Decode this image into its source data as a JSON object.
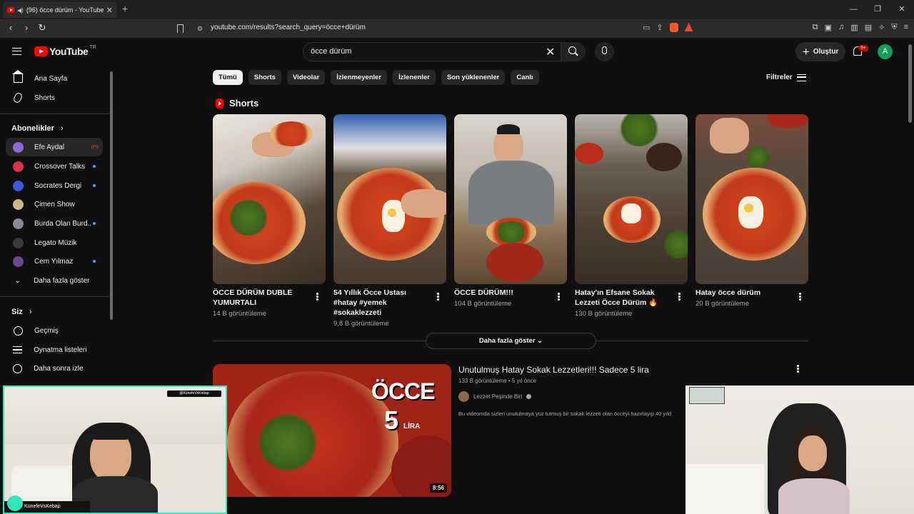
{
  "browser": {
    "tab_title": "(96) öcce dürüm - YouTube",
    "url": "youtube.com/results?search_query=öcce+dürüm"
  },
  "header": {
    "logo_text": "YouTube",
    "logo_region": "TR",
    "search_value": "öcce dürüm",
    "create_label": "Oluştur",
    "notif_count": "9+",
    "avatar_letter": "A"
  },
  "sidebar": {
    "main": [
      {
        "label": "Ana Sayfa",
        "icon": "home-icon"
      },
      {
        "label": "Shorts",
        "icon": "shorts-icon"
      }
    ],
    "subscriptions_title": "Abonelikler",
    "subscriptions": [
      {
        "label": "Efe Aydal",
        "avatar_color": "#8e6ad6",
        "status": "live"
      },
      {
        "label": "Crossover Talks",
        "avatar_color": "#d8344a",
        "status": "new"
      },
      {
        "label": "Socrates Dergi",
        "avatar_color": "#3d5bd6",
        "status": "new"
      },
      {
        "label": "Çimen Show",
        "avatar_color": "#c9b98a",
        "status": ""
      },
      {
        "label": "Burda Olan Burd...",
        "avatar_color": "#8b8b9a",
        "status": "new"
      },
      {
        "label": "Legato Müzik",
        "avatar_color": "#3a3a3a",
        "status": ""
      },
      {
        "label": "Cem Yılmaz",
        "avatar_color": "#6a4a8a",
        "status": "new"
      }
    ],
    "show_more": "Daha fazla göster",
    "you_title": "Siz",
    "you_items": [
      {
        "label": "Geçmiş",
        "icon": "history-icon"
      },
      {
        "label": "Oynatma listeleri",
        "icon": "playlist-icon"
      },
      {
        "label": "Daha sonra izle",
        "icon": "watch-later-icon"
      }
    ]
  },
  "chips": [
    "Tümü",
    "Shorts",
    "Videolar",
    "İzlenmeyenler",
    "İzlenenler",
    "Son yüklenenler",
    "Canlı"
  ],
  "filters_label": "Filtreler",
  "shorts": {
    "title": "Shorts",
    "items": [
      {
        "title": "ÖCCE DÜRÜM DUBLE YUMURTALI",
        "views": "14 B görüntüleme"
      },
      {
        "title": "54 Yıllık Öcce Ustası #hatay #yemek #sokaklezzeti",
        "views": "9,8 B görüntüleme"
      },
      {
        "title": "ÖCCE DÜRÜM!!!",
        "views": "104 B görüntüleme"
      },
      {
        "title": "Hatay'ın Efsane Sokak Lezzeti Öcce Dürüm 🔥",
        "views": "130 B görüntüleme"
      },
      {
        "title": "Hatay öcce dürüm",
        "views": "20 B görüntüleme"
      }
    ],
    "more_label": "Daha fazla göster"
  },
  "video": {
    "title": "Unutulmuş Hatay Sokak Lezzetleri!!! Sadece 5 lira",
    "meta": "133 B görüntüleme • 5 yıl önce",
    "channel": "Lezzet Peşinde Biri",
    "description": "Bu videomda sizleri unutulmaya yüz tutmuş bir sokak lezzeti olan öcceyi hazırlayıp 40 yıld",
    "duration": "8:56",
    "thumb_text_1": "ÖCCE",
    "thumb_text_2": "5",
    "thumb_text_3": "LİRA"
  },
  "webcam": {
    "tag": "@KünefeVsKebap",
    "name": "KünefeVsKebap"
  }
}
